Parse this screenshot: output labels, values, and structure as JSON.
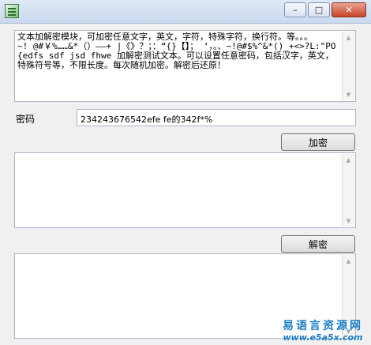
{
  "window": {
    "title": "",
    "minimize_glyph": "–",
    "maximize_glyph": "□",
    "close_glyph": "✕"
  },
  "source_text": "文本加解密模块，可加密任意文字，英文，字符，特殊字符，换行符。等。。。\n~! @#￥%……&*（）——+ |《》？；：“{}【】； ‘，。、~!@#$%^&*()_+<>?L:\"PO{edfs sdf jsd fhwe 加解密测试文本。可以设置任意密码，包括汉字，英文，特殊符号等，不限长度。每次随机加密。解密后还原！",
  "password": {
    "label": "密码",
    "value": "234243676542efe fe的342f*%"
  },
  "encrypt_button": "加密",
  "encrypted_text": "",
  "decrypt_button": "解密",
  "decrypted_text": "",
  "watermark": {
    "line1": "易语言资源网",
    "line2": "www.e5a5x.com"
  }
}
